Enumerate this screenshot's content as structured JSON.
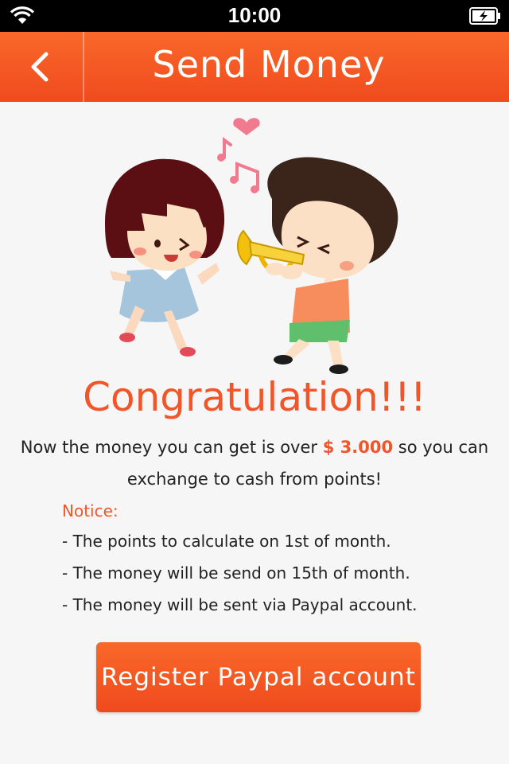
{
  "status_bar": {
    "time": "10:00",
    "wifi_icon": "wifi-icon",
    "battery_icon": "battery-charging-icon"
  },
  "nav": {
    "title": "Send Money",
    "back_icon": "chevron-left-icon"
  },
  "illustration": {
    "description_icon": "kids-trumpet-illustration"
  },
  "headline": "Congratulation!!!",
  "message": {
    "prefix": "Now the money you can get is over",
    "amount": "$ 3.000",
    "suffix": "so you can exchange to cash from points!"
  },
  "notice": {
    "title": "Notice:",
    "lines": [
      "- The points to calculate on 1st of month.",
      "- The money will be send on 15th of month.",
      "- The money will be sent via Paypal account."
    ]
  },
  "button": {
    "label": "Register Paypal account"
  },
  "colors": {
    "accent": "#f0562a",
    "nav_top": "#f9682a",
    "nav_bottom": "#f04b1e"
  }
}
